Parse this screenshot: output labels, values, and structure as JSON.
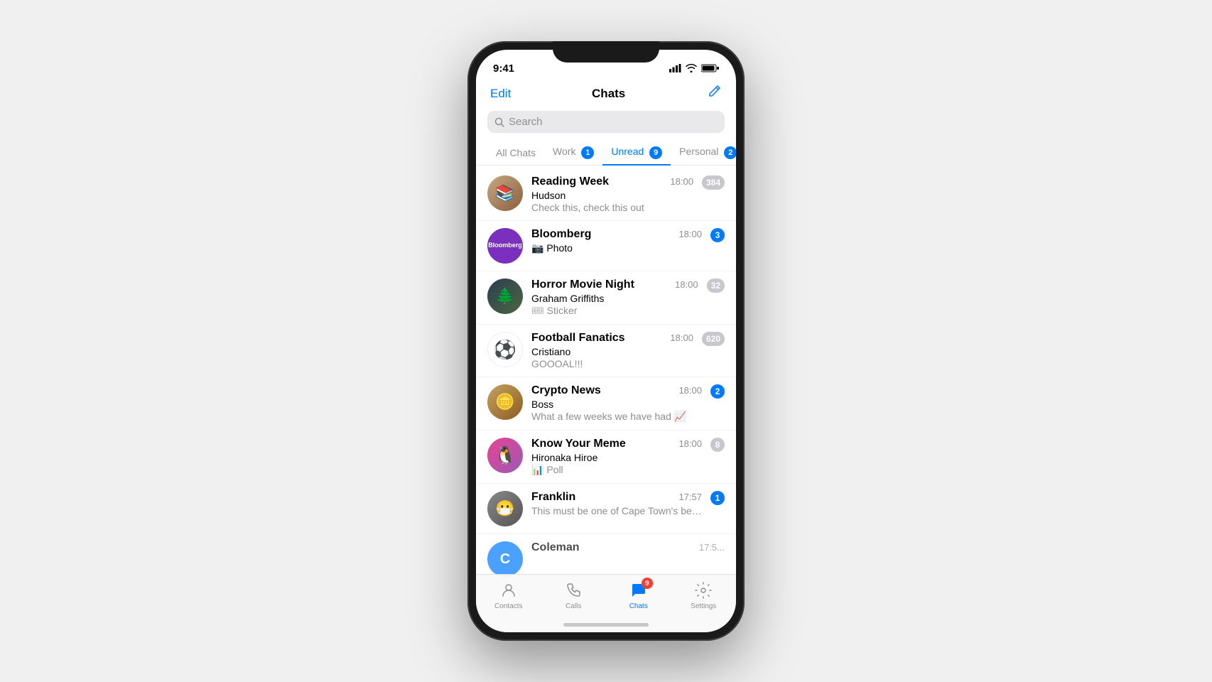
{
  "phone": {
    "status_bar": {
      "time": "9:41"
    },
    "nav": {
      "edit_label": "Edit",
      "title": "Chats",
      "compose_icon": "✏️"
    },
    "search": {
      "placeholder": "Search"
    },
    "filter_tabs": [
      {
        "id": "all",
        "label": "All Chats",
        "badge": null,
        "active": false
      },
      {
        "id": "work",
        "label": "Work",
        "badge": "1",
        "active": false
      },
      {
        "id": "unread",
        "label": "Unread",
        "badge": "9",
        "active": true
      },
      {
        "id": "personal",
        "label": "Personal",
        "badge": "2",
        "active": false
      }
    ],
    "chats": [
      {
        "id": "reading-week",
        "name": "Reading Week",
        "sender": "Hudson",
        "preview": "Check this, check this out",
        "time": "18:00",
        "unread": "384",
        "unread_type": "gray",
        "avatar_type": "reading"
      },
      {
        "id": "bloomberg",
        "name": "Bloomberg",
        "sender": "📷 Photo",
        "preview": "",
        "time": "18:00",
        "unread": "3",
        "unread_type": "blue",
        "avatar_type": "bloomberg"
      },
      {
        "id": "horror-movie-night",
        "name": "Horror Movie Night",
        "sender": "Graham Griffiths",
        "preview": "🎟 Sticker",
        "time": "18:00",
        "unread": "32",
        "unread_type": "gray",
        "avatar_type": "horror"
      },
      {
        "id": "football-fanatics",
        "name": "Football Fanatics",
        "sender": "Cristiano",
        "preview": "GOOOAL!!!",
        "time": "18:00",
        "unread": "620",
        "unread_type": "gray",
        "avatar_type": "football"
      },
      {
        "id": "crypto-news",
        "name": "Crypto News",
        "sender": "Boss",
        "preview": "What a few weeks we have had 📈",
        "time": "18:00",
        "unread": "2",
        "unread_type": "blue",
        "avatar_type": "crypto"
      },
      {
        "id": "know-your-meme",
        "name": "Know Your Meme",
        "sender": "Hironaka Hiroe",
        "preview": "📊 Poll",
        "time": "18:00",
        "unread": "8",
        "unread_type": "gray",
        "avatar_type": "meme"
      },
      {
        "id": "franklin",
        "name": "Franklin",
        "sender": "",
        "preview": "This must be one of Cape Town's best spots for a stunning view of...",
        "time": "17:57",
        "unread": "1",
        "unread_type": "blue",
        "avatar_type": "franklin"
      },
      {
        "id": "coleman",
        "name": "Coleman",
        "sender": "",
        "preview": "",
        "time": "17:5...",
        "unread": null,
        "avatar_type": "coleman"
      }
    ],
    "tab_bar": [
      {
        "id": "contacts",
        "label": "Contacts",
        "icon": "contacts",
        "active": false,
        "badge": null
      },
      {
        "id": "calls",
        "label": "Calls",
        "icon": "calls",
        "active": false,
        "badge": null
      },
      {
        "id": "chats",
        "label": "Chats",
        "icon": "chats",
        "active": true,
        "badge": "9"
      },
      {
        "id": "settings",
        "label": "Settings",
        "icon": "settings",
        "active": false,
        "badge": null
      }
    ]
  }
}
